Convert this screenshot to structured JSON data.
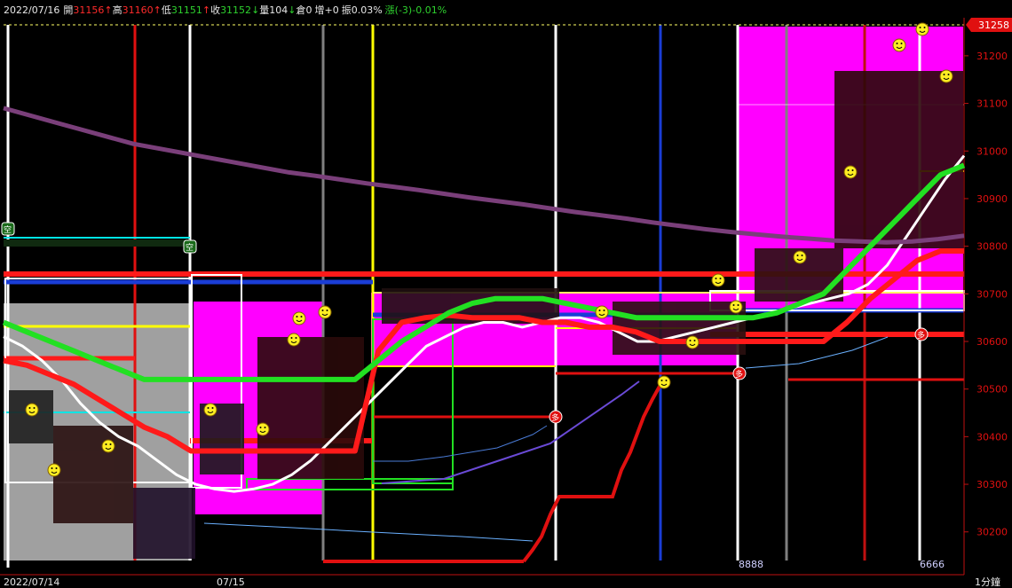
{
  "header": {
    "date": "2022/07/16",
    "open_label": "開",
    "open": "31156",
    "high_label": "高",
    "high": "31160",
    "low_label": "低",
    "low": "31151",
    "close_label": "收",
    "close": "31152",
    "volume_label": "量",
    "volume": "104",
    "oi_label": "倉",
    "oi": "0",
    "oi_change_label": "增",
    "oi_change": "+0",
    "amplitude_label": "振",
    "amplitude": "0.03%",
    "change_label": "漲",
    "change": "(-3)",
    "change_pct": "-0.01%"
  },
  "chart_data": {
    "type": "line",
    "title": "",
    "timeframe": "1分鐘",
    "price_tag": "31258",
    "ylim": [
      30125,
      31265
    ],
    "y_ticks": [
      31200,
      31100,
      31000,
      30900,
      30800,
      30700,
      30600,
      30500,
      30400,
      30300,
      30200
    ],
    "x_labels": [
      "2022/07/14",
      "07/15"
    ],
    "x_marks": [
      "8888",
      "6666"
    ],
    "buy_marker": "多",
    "sell_marker": "空",
    "colors": {
      "up": "#ff2020",
      "down": "#2bd12b",
      "magenta": "#ff00ff",
      "gray": "#a0a0a0",
      "long_ma": "#7a3f7a",
      "ma_white": "#ffffff",
      "ma_red": "#ff1a1a",
      "ma_green": "#22e022",
      "ma_yellow": "#ffff00"
    },
    "series": [
      {
        "values": [
          30610,
          30590,
          30560,
          30520,
          30470,
          30430,
          30400,
          30380,
          30350,
          30320,
          30300,
          30290,
          30285,
          30290,
          30300,
          30320,
          30350,
          30390,
          30430,
          30470,
          30510,
          30550,
          30590,
          30610,
          30630,
          30640,
          30640,
          30630,
          30640,
          30650,
          30650,
          30640,
          30620,
          30600,
          30600,
          30610,
          30620,
          30630,
          30640,
          30650,
          30660,
          30670,
          30680,
          30690,
          30700,
          30720,
          30760,
          30820,
          30880,
          30940,
          30990
        ]
      },
      {
        "values": [
          31090,
          31075,
          31060,
          31045,
          31030,
          31015,
          31005,
          30995,
          30985,
          30975,
          30965,
          30955,
          30948,
          30940,
          30932,
          30925,
          30918,
          30910,
          30902,
          30895,
          30888,
          30880,
          30872,
          30865,
          30858,
          30850,
          30843,
          30836,
          30830,
          30825,
          30820,
          30816,
          30812,
          30810,
          30808,
          30810,
          30815,
          30822
        ]
      },
      {
        "values": [
          30560,
          30550,
          30530,
          30510,
          30480,
          30450,
          30420,
          30400,
          30370,
          30370,
          30370,
          30370,
          30370,
          30370,
          30370,
          30370,
          30580,
          30640,
          30650,
          30655,
          30650,
          30650,
          30650,
          30640,
          30640,
          30630,
          30630,
          30620,
          30600,
          30600,
          30600,
          30600,
          30600,
          30600,
          30600,
          30600,
          30640,
          30690,
          30730,
          30770,
          30790,
          30790
        ]
      },
      {
        "values": [
          30640,
          30620,
          30600,
          30580,
          30560,
          30540,
          30520,
          30520,
          30520,
          30520,
          30520,
          30520,
          30520,
          30520,
          30520,
          30520,
          30560,
          30600,
          30630,
          30660,
          30680,
          30690,
          30690,
          30690,
          30680,
          30670,
          30660,
          30650,
          30650,
          30650,
          30650,
          30650,
          30650,
          30660,
          30680,
          30700,
          30750,
          30800,
          30850,
          30900,
          30950,
          30970
        ]
      }
    ]
  }
}
